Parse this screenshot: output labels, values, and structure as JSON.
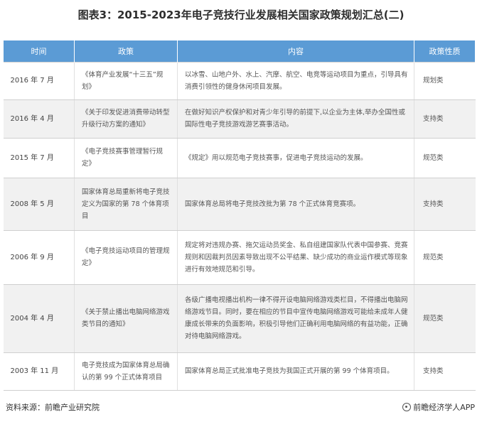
{
  "title": "图表3：2015-2023年电子竞技行业发展相关国家政策规划汇总(二)",
  "table": {
    "headers": [
      "时间",
      "政策",
      "内容",
      "政策性质"
    ],
    "rows": [
      {
        "time": "2016 年 7 月",
        "policy": "《体育产业发展“十三五”规划》",
        "content": "以冰雪、山地户外、水上、汽摩、航空、电竞等运动项目为重点，引导具有消费引领性的健身休闲项目发展。",
        "nature": "规划类"
      },
      {
        "time": "2016 年 4 月",
        "policy": "《关于印发促进消费带动转型升级行动方案的通知》",
        "content": "在做好知识产权保护和对青少年引导的前提下,以企业为主体,举办全国性或国际性电子竞技游戏游艺赛事活动。",
        "nature": "支持类"
      },
      {
        "time": "2015 年 7 月",
        "policy": "《电子竞技赛事管理暂行规定》",
        "content": "《规定》用以规范电子竞技赛事，促进电子竞技运动的发展。",
        "nature": "规范类"
      },
      {
        "time": "2008 年 5 月",
        "policy": "国家体育总局重新将电子竞技定义为国家的第 78 个体育项目",
        "content": "国家体育总局将电子竞技改批为第 78 个正式体育竞赛项。",
        "nature": "支持类"
      },
      {
        "time": "2006 年 9 月",
        "policy": "《电子竞技运动项目的管理规定》",
        "content": "规定将对违规办赛、拖欠运动员奖金、私自组建国家队代表中国参赛、竞赛规则和因裁判员因素导致出现不公平结果、缺少成功的商业运作模式等现象进行有效地规范和引导。",
        "nature": "规范类"
      },
      {
        "time": "2004 年 4 月",
        "policy": "《关于禁止播出电脑网络游戏类节目的通知》",
        "content": "各级广播电视播出机构一律不得开设电脑网络游戏类栏目，不得播出电脑网络游戏节目。同时，要在相应的节目中宣传电脑网络游戏可能给未成年人健康成长带来的负面影响，积极引导他们正确利用电脑网络的有益功能，正确对待电脑网络游戏。",
        "nature": "规范类"
      },
      {
        "time": "2003 年 11 月",
        "policy": "电子竞技成为国家体育总局确认的第 99 个正式体育项目",
        "content": "国家体育总局正式批准电子竞技为我国正式开展的第 99 个体育项目。",
        "nature": "支持类"
      }
    ]
  },
  "footer": {
    "source": "资料来源：前瞻产业研究院",
    "brand": "前瞻经济学人APP"
  }
}
